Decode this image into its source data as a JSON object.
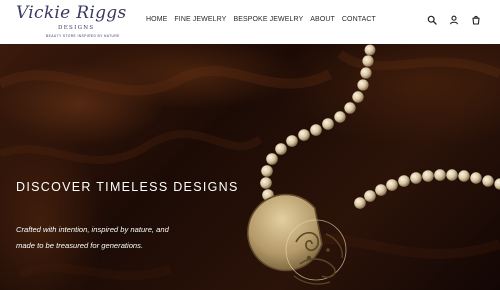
{
  "brand": {
    "script_name": "Vickie Riggs",
    "sub_name": "DESIGNS",
    "tagline": "BEAUTY STORE INSPIRED BY NATURE"
  },
  "nav": {
    "items": [
      {
        "label": "HOME"
      },
      {
        "label": "FINE JEWELRY"
      },
      {
        "label": "BESPOKE JEWELRY"
      },
      {
        "label": "ABOUT"
      },
      {
        "label": "CONTACT"
      }
    ]
  },
  "header_icons": [
    "search-icon",
    "account-icon",
    "cart-icon"
  ],
  "hero": {
    "title": "DISCOVER TIMELESS DESIGNS",
    "body": "Crafted with intention, inspired by nature, and made to be treasured for generations."
  },
  "colors": {
    "brand_navy": "#3a3960",
    "hero_bg": "#2b1309",
    "pearl": "#e6d8bd",
    "pendant_gold": "#b59a6a"
  }
}
